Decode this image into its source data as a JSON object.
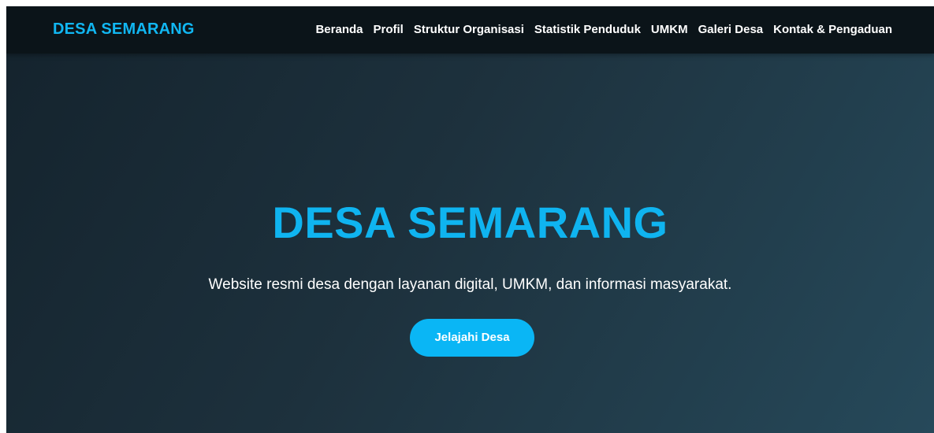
{
  "header": {
    "brand": "DESA SEMARANG",
    "nav": [
      {
        "label": "Beranda"
      },
      {
        "label": "Profil"
      },
      {
        "label": "Struktur Organisasi"
      },
      {
        "label": "Statistik Penduduk"
      },
      {
        "label": "UMKM"
      },
      {
        "label": "Galeri Desa"
      },
      {
        "label": "Kontak & Pengaduan"
      }
    ]
  },
  "hero": {
    "title": "DESA SEMARANG",
    "subtitle": "Website resmi desa dengan layanan digital, UMKM, dan informasi masyarakat.",
    "cta_label": "Jelajahi Desa"
  },
  "colors": {
    "accent": "#0fb4f0",
    "navbar_bg": "#0b1419",
    "hero_bg_start": "#14232d",
    "hero_bg_end": "#26495a"
  }
}
